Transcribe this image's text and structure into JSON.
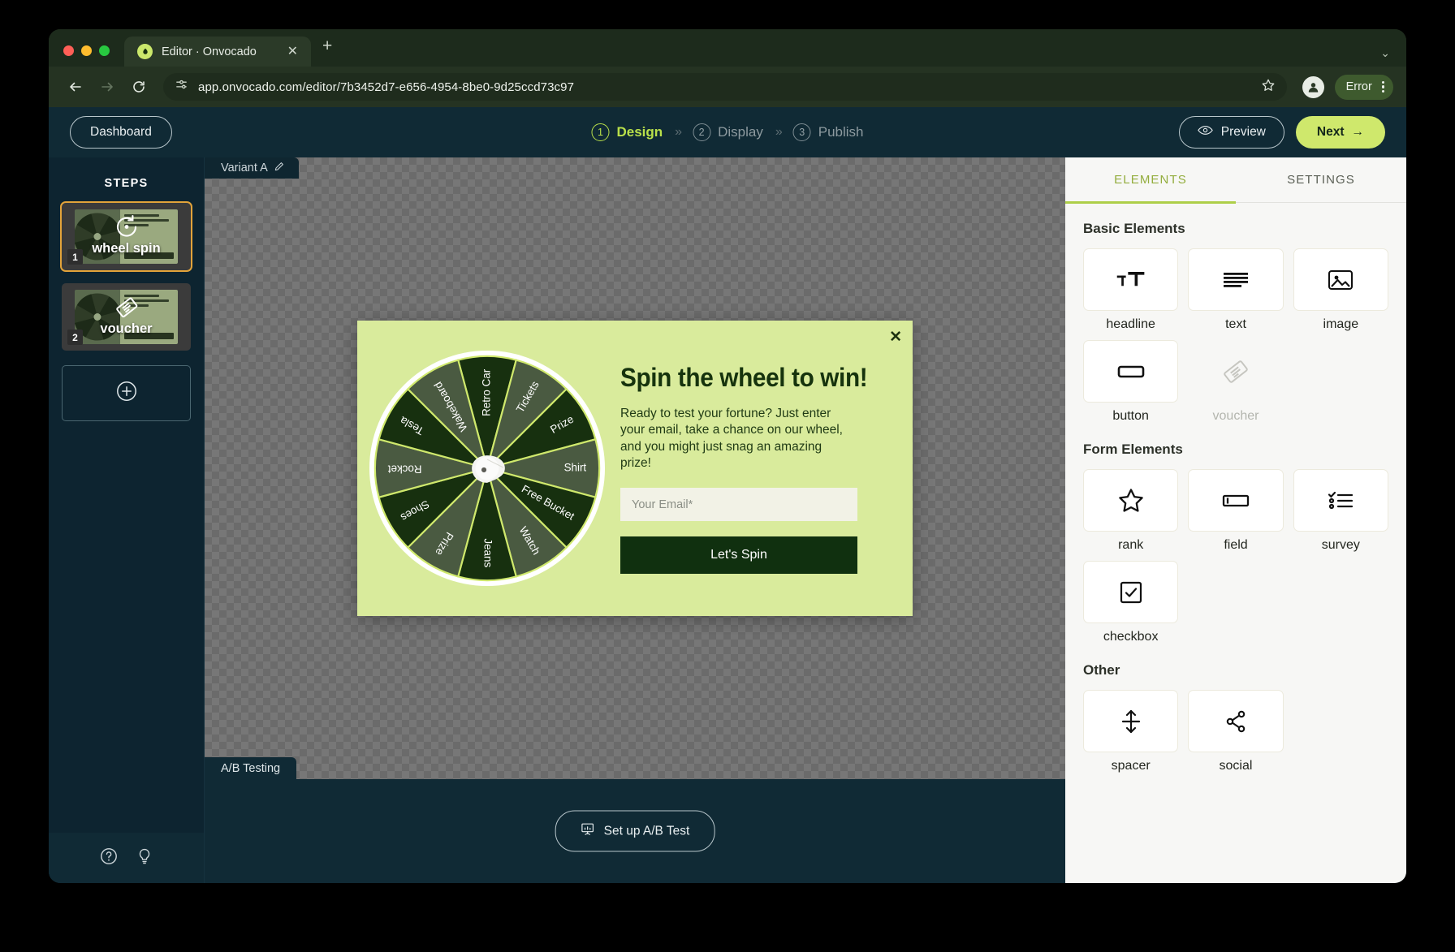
{
  "browser": {
    "tab_title": "Editor · Onvocado",
    "tab_close": "✕",
    "new_tab": "+",
    "tabstrip_chevron": "⌄",
    "url": "app.onvocado.com/editor/7b3452d7-e656-4954-8be0-9d25ccd73c97",
    "error_label": "Error"
  },
  "header": {
    "dashboard_label": "Dashboard",
    "steps": [
      {
        "num": "1",
        "label": "Design",
        "active": true
      },
      {
        "num": "2",
        "label": "Display",
        "active": false
      },
      {
        "num": "3",
        "label": "Publish",
        "active": false
      }
    ],
    "separator": "»",
    "preview_label": "Preview",
    "next_label": "Next",
    "next_arrow": "→"
  },
  "steps_panel": {
    "title": "STEPS",
    "items": [
      {
        "num": "1",
        "label": "wheel spin",
        "selected": true
      },
      {
        "num": "2",
        "label": "voucher",
        "selected": false
      }
    ]
  },
  "canvas": {
    "variant_label": "Variant A",
    "ab_tab_label": "A/B Testing",
    "ab_button_label": "Set up A/B Test"
  },
  "popup": {
    "close": "✕",
    "headline": "Spin the wheel to win!",
    "body": "Ready to test your fortune? Just enter your email, take a chance on our wheel, and you might just snag an amazing prize!",
    "email_placeholder": "Your Email*",
    "cta_label": "Let's Spin",
    "background": "#d9eb9c",
    "cta_background": "#10300f",
    "wheel_segments": [
      "Retro Car",
      "Tickets",
      "Prize",
      "Shirt",
      "Free Bucket",
      "Watch",
      "Jeans",
      "Prize",
      "Shoes",
      "Rocket",
      "Tesla",
      "Wakeboard"
    ],
    "wheel_colors": [
      "#17300f",
      "#4a5a41"
    ]
  },
  "right_panel": {
    "tabs": [
      {
        "label": "ELEMENTS",
        "active": true
      },
      {
        "label": "SETTINGS",
        "active": false
      }
    ],
    "sections": [
      {
        "title": "Basic Elements",
        "items": [
          {
            "label": "headline",
            "icon": "headline-icon",
            "disabled": false
          },
          {
            "label": "text",
            "icon": "text-icon",
            "disabled": false
          },
          {
            "label": "image",
            "icon": "image-icon",
            "disabled": false
          },
          {
            "label": "button",
            "icon": "button-icon",
            "disabled": false
          },
          {
            "label": "voucher",
            "icon": "voucher-icon",
            "disabled": true
          }
        ]
      },
      {
        "title": "Form Elements",
        "items": [
          {
            "label": "rank",
            "icon": "star-icon",
            "disabled": false
          },
          {
            "label": "field",
            "icon": "field-icon",
            "disabled": false
          },
          {
            "label": "survey",
            "icon": "survey-icon",
            "disabled": false
          },
          {
            "label": "checkbox",
            "icon": "checkbox-icon",
            "disabled": false
          }
        ]
      },
      {
        "title": "Other",
        "items": [
          {
            "label": "spacer",
            "icon": "spacer-icon",
            "disabled": false
          },
          {
            "label": "social",
            "icon": "social-icon",
            "disabled": false
          }
        ]
      }
    ]
  },
  "accent": {
    "lime": "#cfe86c",
    "panel_lime": "#aecf49",
    "amber": "#e2a33a"
  }
}
